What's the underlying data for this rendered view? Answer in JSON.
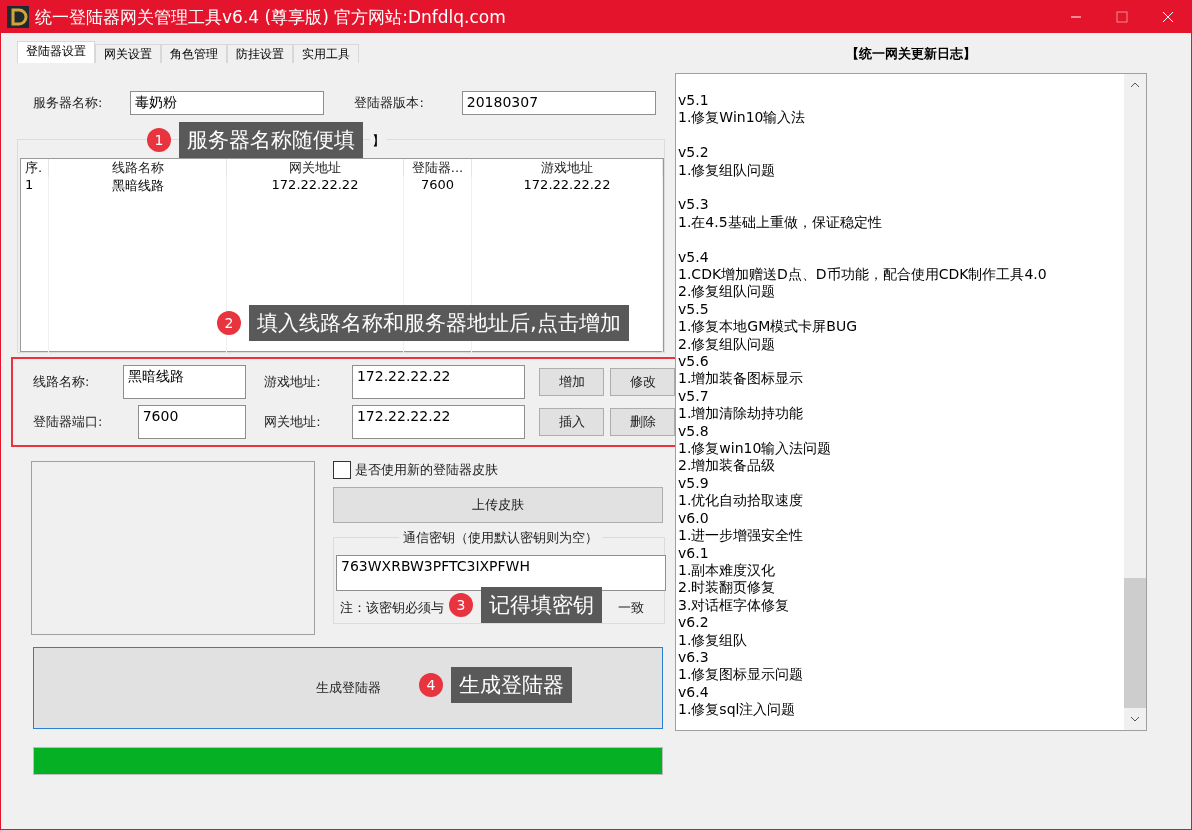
{
  "window": {
    "title": "统一登陆器网关管理工具v6.4 (尊享版)  官方网站:Dnfdlq.com"
  },
  "tabs": [
    {
      "label": "登陆器设置",
      "selected": true
    },
    {
      "label": "网关设置",
      "selected": false
    },
    {
      "label": "角色管理",
      "selected": false
    },
    {
      "label": "防挂设置",
      "selected": false
    },
    {
      "label": "实用工具",
      "selected": false
    }
  ],
  "server": {
    "name_label": "服务器名称:",
    "name_value": "毒奶粉",
    "version_label": "登陆器版本:",
    "version_value": "20180307"
  },
  "routes_group": {
    "title_visible": "】"
  },
  "table": {
    "columns": [
      "序.",
      "线路名称",
      "网关地址",
      "登陆器...",
      "游戏地址"
    ],
    "rows": [
      {
        "cells": [
          "1",
          "黑暗线路",
          "172.22.22.22",
          "7600",
          "172.22.22.22"
        ],
        "selected": false
      }
    ]
  },
  "route_form": {
    "route_name_label": "线路名称:",
    "route_name_value": "黑暗线路",
    "game_addr_label": "游戏地址:",
    "game_addr_value": "172.22.22.22",
    "port_label": "登陆器端口:",
    "port_value": "7600",
    "gateway_label": "网关地址:",
    "gateway_value": "172.22.22.22",
    "buttons": [
      "增加",
      "修改",
      "插入",
      "删除"
    ]
  },
  "skin": {
    "checkbox_label": "是否使用新的登陆器皮肤",
    "checked": false,
    "upload_button": "上传皮肤"
  },
  "key_group": {
    "title": "通信密钥（使用默认密钥则为空）",
    "value": "763WXRBW3PFTC3IXPFWH",
    "note_start": "注：该密钥必须与",
    "note_end": "一致"
  },
  "generate_button": "生成登陆器",
  "progress": {
    "level": 1
  },
  "changelog": {
    "title": "【统一网关更新日志】",
    "entries": [
      {
        "version": "v5.1",
        "items": [
          "1.修复Win10输入法"
        ],
        "spaced": true
      },
      {
        "version": "v5.2",
        "items": [
          "1.修复组队问题"
        ],
        "spaced": true
      },
      {
        "version": "v5.3",
        "items": [
          "1.在4.5基础上重做，保证稳定性"
        ],
        "spaced": true
      },
      {
        "version": "v5.4",
        "items": [
          "1.CDK增加赠送D点、D币功能，配合使用CDK制作工具4.0",
          "2.修复组队问题"
        ],
        "spaced": false
      },
      {
        "version": "v5.5",
        "items": [
          "1.修复本地GM模式卡屏BUG",
          "2.修复组队问题"
        ],
        "spaced": false
      },
      {
        "version": "v5.6",
        "items": [
          "1.增加装备图标显示"
        ],
        "spaced": false
      },
      {
        "version": "v5.7",
        "items": [
          "1.增加清除劫持功能"
        ],
        "spaced": false
      },
      {
        "version": "v5.8",
        "items": [
          "1.修复win10输入法问题",
          "2.增加装备品级"
        ],
        "spaced": false
      },
      {
        "version": "v5.9",
        "items": [
          "1.优化自动拾取速度"
        ],
        "spaced": false
      },
      {
        "version": "v6.0",
        "items": [
          "1.进一步增强安全性"
        ],
        "spaced": false
      },
      {
        "version": "v6.1",
        "items": [
          "1.副本难度汉化",
          "2.时装翻页修复",
          "3.对话框字体修复"
        ],
        "spaced": false
      },
      {
        "version": "v6.2",
        "items": [
          "1.修复组队"
        ],
        "spaced": false
      },
      {
        "version": "v6.3",
        "items": [
          "1.修复图标显示问题"
        ],
        "spaced": false
      },
      {
        "version": "v6.4",
        "items": [
          "1.修复sql注入问题"
        ],
        "spaced": false
      }
    ]
  },
  "callouts": [
    {
      "number": "1",
      "text": "服务器名称随便填"
    },
    {
      "number": "2",
      "text": "填入线路名称和服务器地址后,点击增加"
    },
    {
      "number": "3",
      "text": "记得填密钥"
    },
    {
      "number": "4",
      "text": "生成登陆器"
    }
  ]
}
